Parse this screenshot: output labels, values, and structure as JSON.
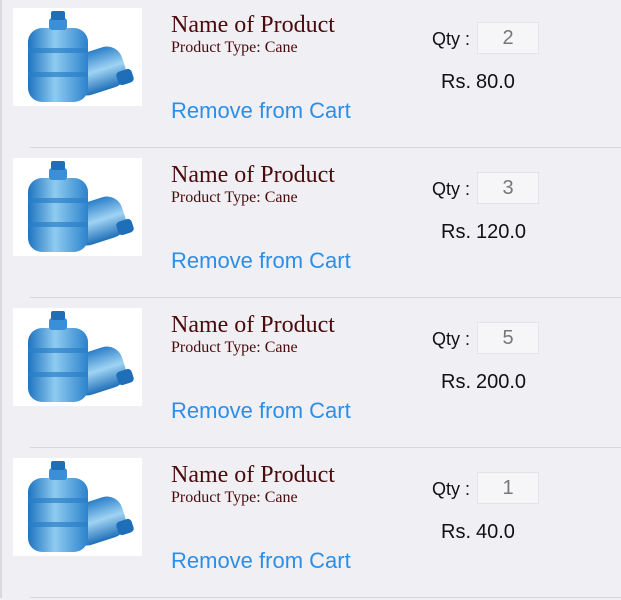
{
  "cart": {
    "items": [
      {
        "name": "Name of Product",
        "type_label": "Product Type:",
        "type_value": "Cane",
        "qty_label": "Qty :",
        "qty": "2",
        "currency": "Rs.",
        "price": "80.0",
        "remove_label": "Remove from Cart",
        "image_icon": "water-bottle-image"
      },
      {
        "name": "Name of Product",
        "type_label": "Product Type:",
        "type_value": "Cane",
        "qty_label": "Qty :",
        "qty": "3",
        "currency": "Rs.",
        "price": "120.0",
        "remove_label": "Remove from Cart",
        "image_icon": "water-bottle-image"
      },
      {
        "name": "Name of Product",
        "type_label": "Product Type:",
        "type_value": "Cane",
        "qty_label": "Qty :",
        "qty": "5",
        "currency": "Rs.",
        "price": "200.0",
        "remove_label": "Remove from Cart",
        "image_icon": "water-bottle-image"
      },
      {
        "name": "Name of Product",
        "type_label": "Product Type:",
        "type_value": "Cane",
        "qty_label": "Qty :",
        "qty": "1",
        "currency": "Rs.",
        "price": "40.0",
        "remove_label": "Remove from Cart",
        "image_icon": "water-bottle-image"
      }
    ]
  },
  "colors": {
    "background": "#efeff4",
    "product_name": "#4a0a0a",
    "link": "#2b8fe8",
    "bottle": "#4aa6dd"
  }
}
